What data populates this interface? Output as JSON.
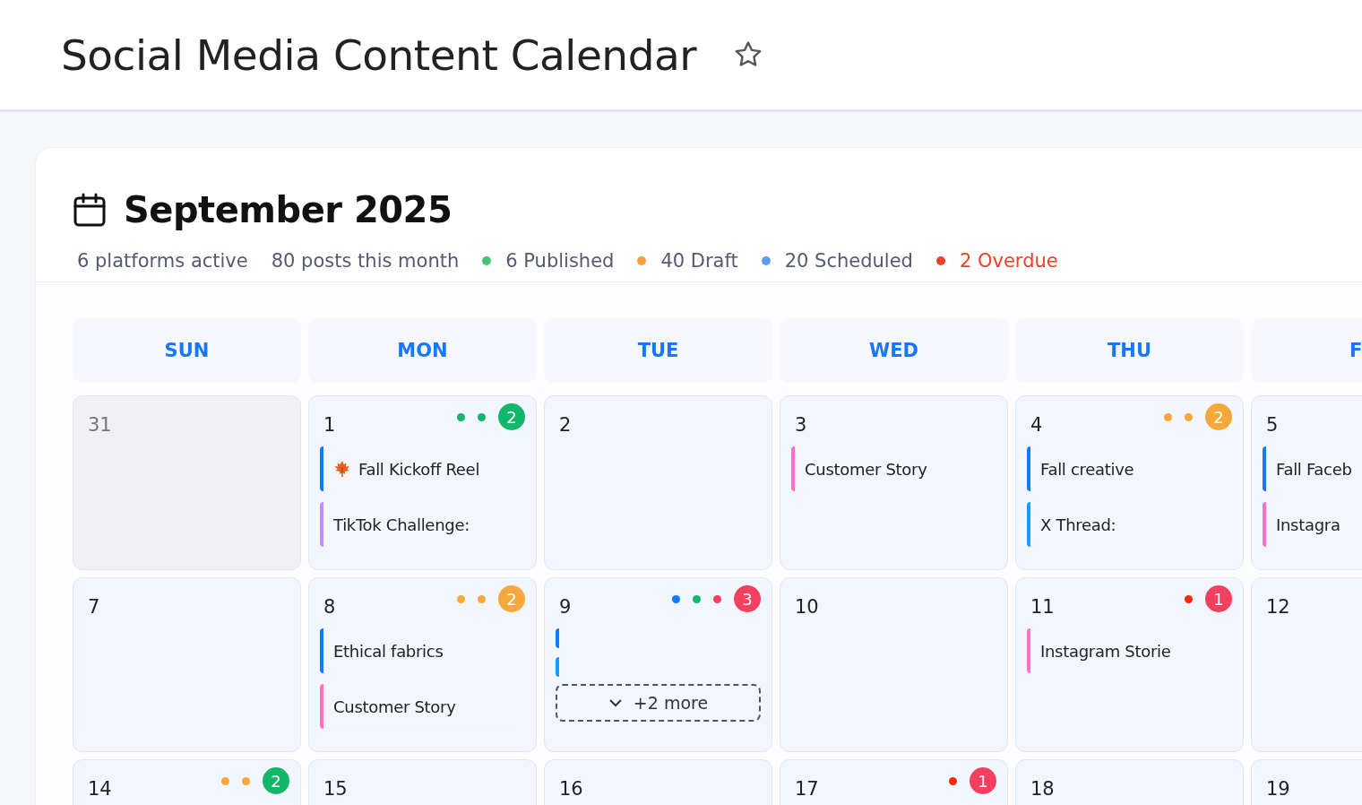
{
  "page_title": "Social Media Content Calendar",
  "favorite": false,
  "month": {
    "title": "September 2025",
    "stats": [
      {
        "text": "6 platforms active"
      },
      {
        "text": "80 posts this month"
      },
      {
        "text": "6 Published",
        "color": "#3cc878"
      },
      {
        "text": "40 Draft",
        "color": "#f7a03a"
      },
      {
        "text": "20 Scheduled",
        "color": "#5b9cf5"
      },
      {
        "text": "2 Overdue",
        "color": "#f0402a",
        "alert": true
      }
    ]
  },
  "weekdays": [
    "SUN",
    "MON",
    "TUE",
    "WED",
    "THU",
    "F"
  ],
  "weeks": [
    [
      {
        "number": "31",
        "muted": true
      },
      {
        "number": "1",
        "muted": false,
        "dots": [
          {
            "color": "#12b76a"
          },
          {
            "color": "#12b76a"
          }
        ],
        "badge": {
          "count": "2",
          "color": "#12b76a"
        },
        "posts": [
          {
            "kind": "leaf",
            "title": "Fall Kickoff Reel",
            "color": "#1677ff"
          },
          {
            "kind": "text",
            "title": "TikTok Challenge:",
            "color": "#c08cf7"
          }
        ]
      },
      {
        "number": "2",
        "muted": false
      },
      {
        "number": "3",
        "muted": false,
        "posts": [
          {
            "kind": "text",
            "title": "Customer Story",
            "color": "#ff6fc8"
          }
        ]
      },
      {
        "number": "4",
        "muted": false,
        "dots": [
          {
            "color": "#f7a83a"
          },
          {
            "color": "#f7a83a"
          }
        ],
        "badge": {
          "count": "2",
          "color": "#f7a83a"
        },
        "posts": [
          {
            "kind": "text",
            "title": "Fall creative",
            "color": "#1677ff"
          },
          {
            "kind": "text",
            "title": "X Thread:",
            "color": "#1a9bff"
          }
        ]
      },
      {
        "number": "5",
        "muted": false,
        "posts": [
          {
            "kind": "text",
            "title": "Fall Faceb",
            "color": "#1677ff"
          },
          {
            "kind": "text",
            "title": "Instagra",
            "color": "#ff6fc8"
          }
        ]
      }
    ],
    [
      {
        "number": "7",
        "muted": false
      },
      {
        "number": "8",
        "muted": false,
        "dots": [
          {
            "color": "#f7a83a"
          },
          {
            "color": "#f7a83a"
          }
        ],
        "badge": {
          "count": "2",
          "color": "#f7a83a"
        },
        "posts": [
          {
            "kind": "text",
            "title": "Ethical fabrics",
            "color": "#1677ff"
          },
          {
            "kind": "text",
            "title": "Customer Story",
            "color": "#ff6fc8"
          }
        ]
      },
      {
        "number": "9",
        "muted": false,
        "dots": [
          {
            "color": "#1677ff"
          },
          {
            "color": "#12b76a"
          },
          {
            "color": "#f43f5e"
          }
        ],
        "badge": {
          "count": "3",
          "color": "#f43f5e"
        },
        "posts": [
          {
            "kind": "marker",
            "color": "#1677ff"
          },
          {
            "kind": "marker",
            "color": "#1a9bff"
          }
        ],
        "more": "+2 more"
      },
      {
        "number": "10",
        "muted": false
      },
      {
        "number": "11",
        "muted": false,
        "dots": [
          {
            "color": "#f52a0a"
          }
        ],
        "badge": {
          "count": "1",
          "color": "#f43f5e"
        },
        "posts": [
          {
            "kind": "text",
            "title": "Instagram Storie",
            "color": "#ff6fc8"
          }
        ]
      },
      {
        "number": "12",
        "muted": false
      }
    ],
    [
      {
        "number": "14",
        "muted": false,
        "dots": [
          {
            "color": "#f7a83a"
          },
          {
            "color": "#f7a83a"
          }
        ],
        "badge": {
          "count": "2",
          "color": "#12b76a"
        }
      },
      {
        "number": "15",
        "muted": false
      },
      {
        "number": "16",
        "muted": false
      },
      {
        "number": "17",
        "muted": false,
        "dots": [
          {
            "color": "#f52a0a"
          }
        ],
        "badge": {
          "count": "1",
          "color": "#f43f5e"
        }
      },
      {
        "number": "18",
        "muted": false
      },
      {
        "number": "19",
        "muted": false
      }
    ]
  ]
}
